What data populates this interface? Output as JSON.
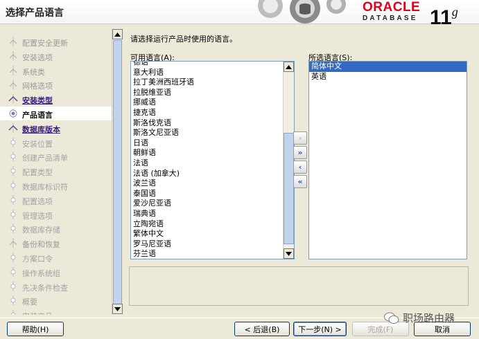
{
  "header": {
    "title": "选择产品语言",
    "brand_top": "ORACLE",
    "brand_bottom": "DATABASE",
    "version_major": "11",
    "version_suffix": "g"
  },
  "steps": [
    {
      "label": "配置安全更新",
      "state": "done"
    },
    {
      "label": "安装选项",
      "state": "done"
    },
    {
      "label": "系统类",
      "state": "done"
    },
    {
      "label": "网格选项",
      "state": "done"
    },
    {
      "label": "安装类型",
      "state": "link"
    },
    {
      "label": "产品语言",
      "state": "current"
    },
    {
      "label": "数据库版本",
      "state": "link"
    },
    {
      "label": "安装位置",
      "state": "pending"
    },
    {
      "label": "创建产品清单",
      "state": "pending"
    },
    {
      "label": "配置类型",
      "state": "pending"
    },
    {
      "label": "数据库标识符",
      "state": "pending"
    },
    {
      "label": "配置选项",
      "state": "pending"
    },
    {
      "label": "管理选项",
      "state": "pending"
    },
    {
      "label": "数据库存储",
      "state": "pending"
    },
    {
      "label": "备份和恢复",
      "state": "done"
    },
    {
      "label": "方案口令",
      "state": "pending"
    },
    {
      "label": "操作系统组",
      "state": "pending"
    },
    {
      "label": "先决条件检查",
      "state": "pending"
    },
    {
      "label": "概要",
      "state": "pending"
    },
    {
      "label": "安装产品",
      "state": "pending"
    }
  ],
  "main": {
    "instruction": "请选择运行产品时使用的语言。",
    "available_label": "可用语言(A):",
    "selected_label": "所选语言(S):",
    "available_languages": [
      "德语",
      "意大利语",
      "拉丁美洲西班牙语",
      "拉脱维亚语",
      "挪威语",
      "捷克语",
      "斯洛伐克语",
      "斯洛文尼亚语",
      "日语",
      "朝鲜语",
      "法语",
      "法语 (加拿大)",
      "波兰语",
      "泰国语",
      "爱沙尼亚语",
      "瑞典语",
      "立陶宛语",
      "繁体中文",
      "罗马尼亚语",
      "芬兰语"
    ],
    "selected_languages": [
      "简体中文",
      "英语"
    ],
    "move_buttons": [
      {
        "glyph": "›",
        "name": "add-button",
        "enabled": false
      },
      {
        "glyph": "»",
        "name": "add-all-button",
        "enabled": true
      },
      {
        "glyph": "‹",
        "name": "remove-button",
        "enabled": true
      },
      {
        "glyph": "«",
        "name": "remove-all-button",
        "enabled": true
      }
    ]
  },
  "footer": {
    "help": "帮助(H)",
    "back": "< 后退(B)",
    "next": "下一步(N) >",
    "finish": "完成(F)",
    "cancel": "取消"
  },
  "watermark": "职场路由器",
  "colors": {
    "oracle_red": "#e0001a",
    "selection_blue": "#316ac5",
    "link_purple": "#3a207a",
    "window_bg": "#ece9d8"
  }
}
